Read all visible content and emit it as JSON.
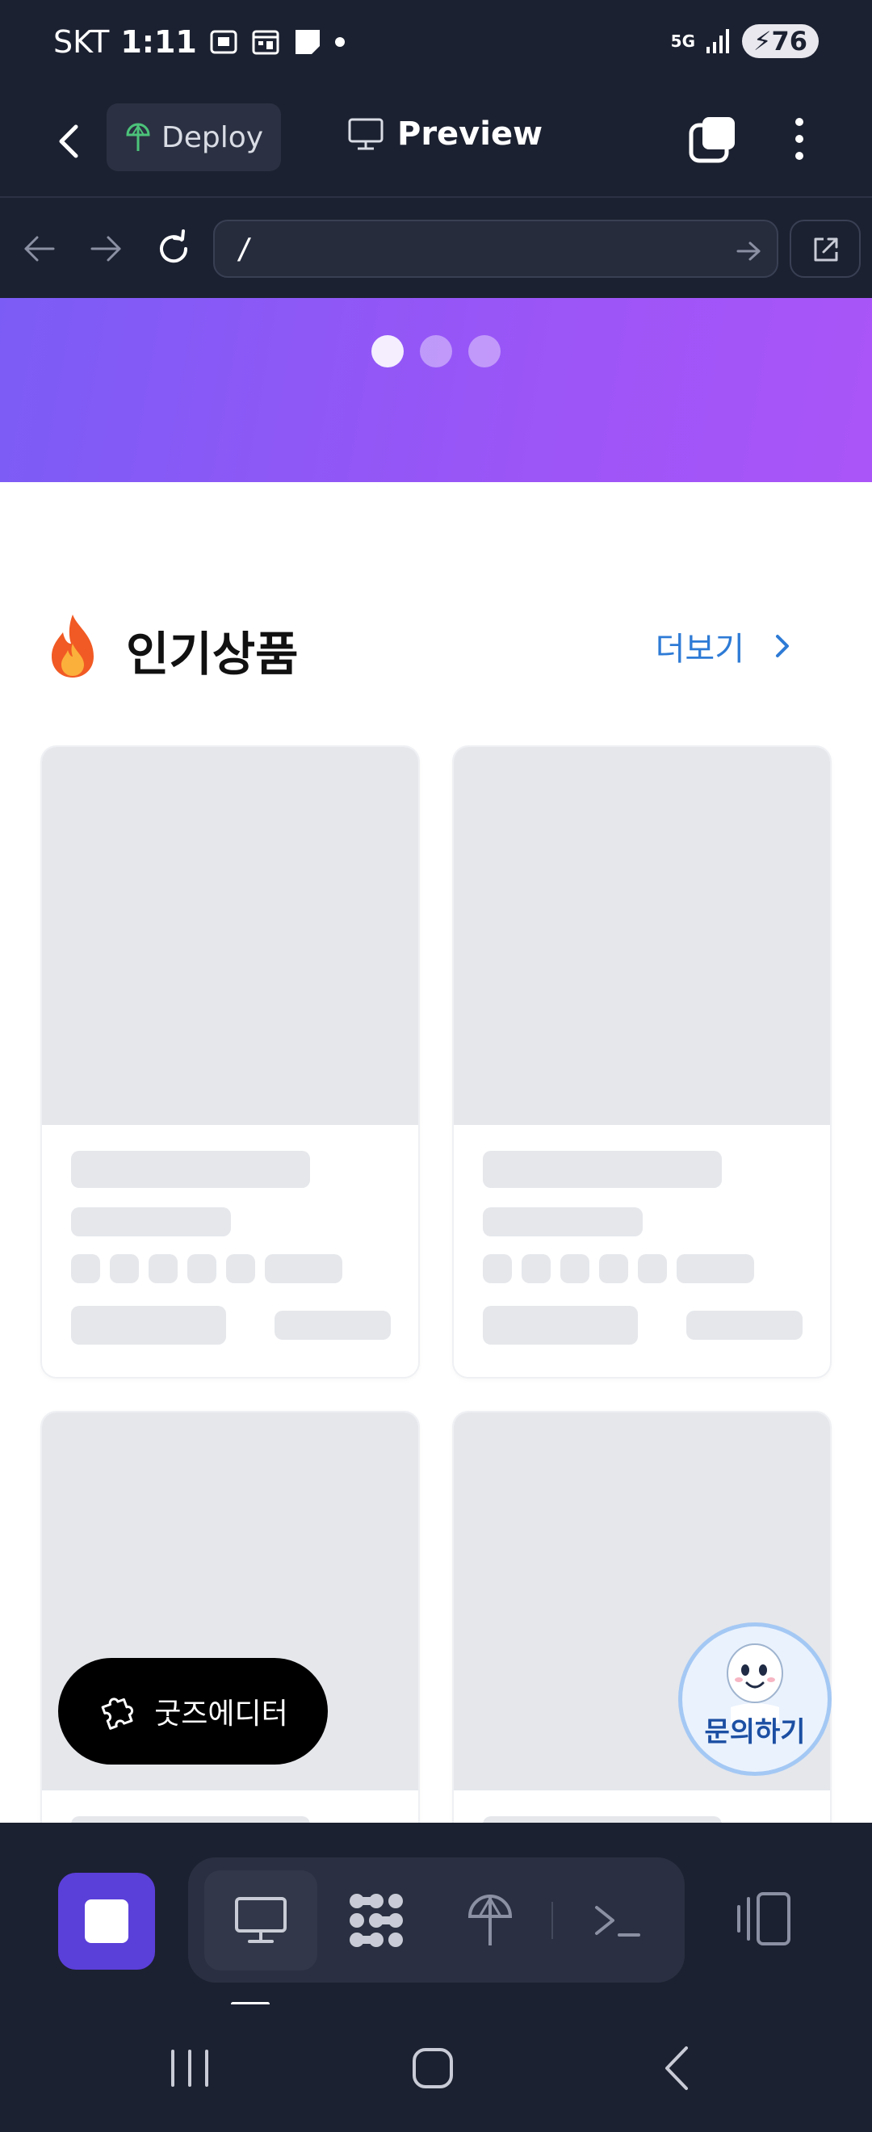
{
  "status_bar": {
    "carrier": "SKT",
    "time": "1:11",
    "network": "5G",
    "battery": "76"
  },
  "header": {
    "deploy_label": "Deploy",
    "title": "Preview"
  },
  "url_bar": {
    "url": "/"
  },
  "banner": {
    "slides": 3,
    "active_slide": 1,
    "gradient_start": "#7b5cf5",
    "gradient_end": "#aa55f8"
  },
  "section": {
    "title": "인기상품",
    "more_label": "더보기"
  },
  "fab": {
    "goods_editor_label": "굿즈에디터",
    "inquiry_label": "문의하기"
  },
  "colors": {
    "app_bg": "#1c2131",
    "accent": "#5b3fd9",
    "link": "#2e7bd6",
    "skeleton": "#e5e7eb"
  },
  "toolbar": {
    "icons": [
      "stop-icon",
      "monitor-icon",
      "grid-dots-icon",
      "deploy-icon",
      "terminal-icon",
      "panel-icon"
    ]
  }
}
